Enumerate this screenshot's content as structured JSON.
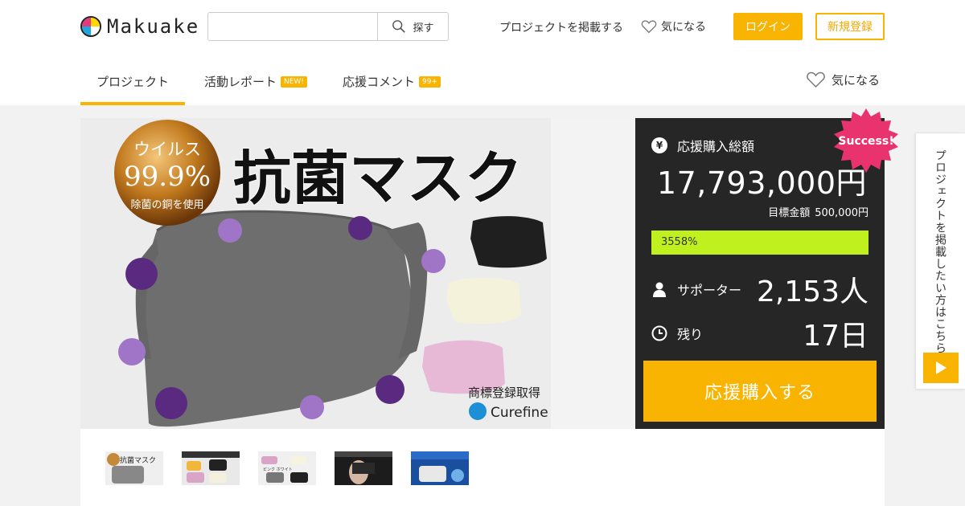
{
  "brand": {
    "logo_text": "Makuake"
  },
  "header": {
    "search_placeholder": "",
    "search_button": "探す",
    "post_project": "プロジェクトを掲載する",
    "favorite": "気になる",
    "login": "ログイン",
    "signup": "新規登録"
  },
  "tabs": [
    {
      "label": "プロジェクト",
      "active": true
    },
    {
      "label": "活動レポート",
      "badge": "NEW!"
    },
    {
      "label": "応援コメント",
      "badge": "99+"
    }
  ],
  "tab_favorite": "気になる",
  "hero": {
    "headline": "抗菌マスク",
    "circle_line1": "ウイルス",
    "circle_line2": "99.9%",
    "circle_line3": "除菌の銅を使用",
    "trademark": "商標登録取得",
    "brand_logo": "Curefine"
  },
  "stats": {
    "total_label": "応援購入総額",
    "total_amount": "17,793,000円",
    "goal_label": "目標金額",
    "goal_amount": "500,000円",
    "progress_text": "3558%",
    "progress_fraction": 1.0,
    "supporters_label": "サポーター",
    "supporters_value": "2,153人",
    "remaining_label": "残り",
    "remaining_value": "17日",
    "buy_button": "応援購入する",
    "success_badge": "Success!"
  },
  "side_tab": {
    "text": "プロジェクトを掲載したい方はこちら"
  },
  "thumbnails": [
    {
      "caption": "抗菌マスク"
    },
    {
      "caption": ""
    },
    {
      "caption": "ピンク ホワイト"
    },
    {
      "caption": ""
    },
    {
      "caption": ""
    }
  ],
  "colors": {
    "accent": "#f8b400",
    "panel": "#262626",
    "progress": "#c0f01e",
    "success": "#e8336e"
  },
  "icons": [
    "search-icon",
    "heart-icon",
    "yen-icon",
    "user-icon",
    "clock-icon",
    "play-icon"
  ]
}
